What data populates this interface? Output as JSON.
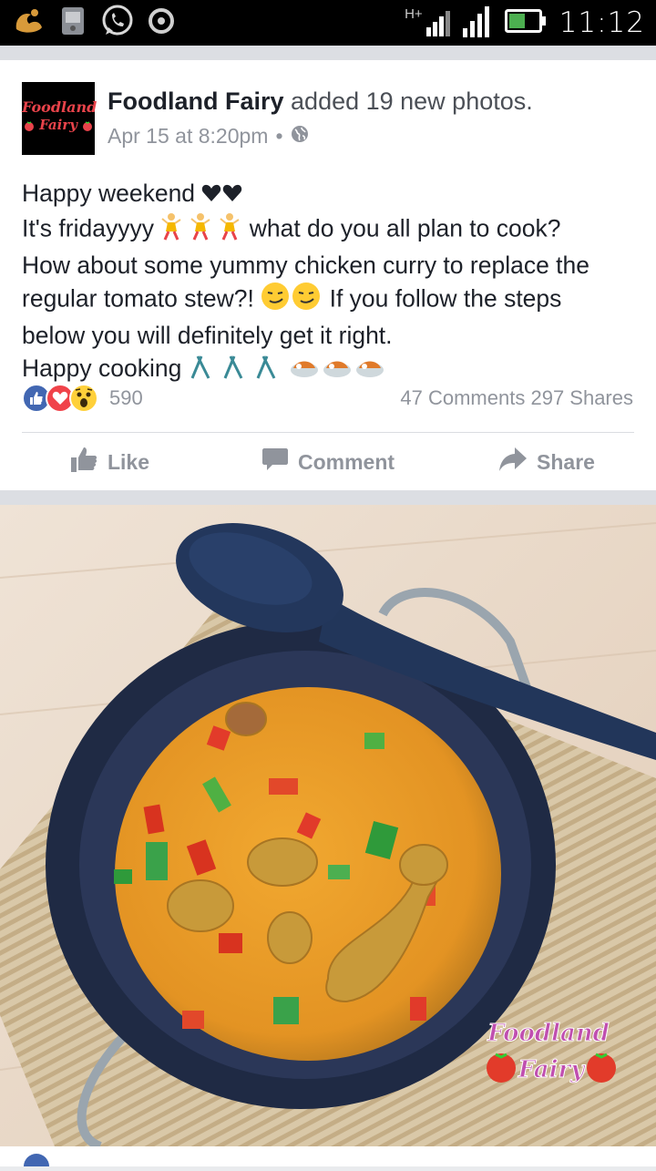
{
  "status_bar": {
    "time": "11:12",
    "network_label": "H+",
    "icons": [
      "uc-browser-icon",
      "sim-manager-icon",
      "whatsapp-icon",
      "record-icon",
      "signal-icon",
      "battery-icon"
    ]
  },
  "post": {
    "page_name": "Foodland Fairy",
    "action_text": "added 19 new photos.",
    "timestamp": "Apr 15 at 8:20pm",
    "privacy_separator": "•",
    "avatar_text_line1": "Foodland",
    "avatar_text_line2": "Fairy",
    "body": {
      "line1": "Happy weekend",
      "line2_prefix": "It's fridayyyy",
      "line2_suffix": "what do you all plan to cook?",
      "line3": "How about some yummy chicken curry to replace the",
      "line4_prefix": "regular tomato stew?!",
      "line4_suffix": "If you follow the steps",
      "line5": "below you will definitely get it right.",
      "line6": "Happy cooking"
    },
    "reactions": {
      "types": [
        "like",
        "love",
        "wow"
      ],
      "count": "590"
    },
    "comments": "47 Comments",
    "shares": "297 Shares",
    "actions": {
      "like": "Like",
      "comment": "Comment",
      "share": "Share"
    }
  },
  "photo": {
    "watermark_line1": "Foodland",
    "watermark_line2": "Fairy"
  },
  "colors": {
    "facebook_blue": "#4267b2",
    "love_red": "#f0434a",
    "wow_yellow": "#ffd03a",
    "gray_text": "#90949c"
  }
}
